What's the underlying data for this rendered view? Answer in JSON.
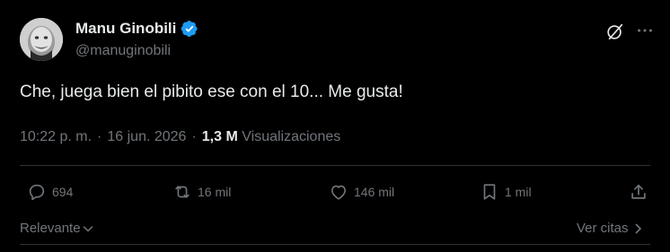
{
  "author": {
    "name": "Manu Ginobili",
    "handle": "@manuginobili",
    "verified": true,
    "verified_color": "#1d9bf0"
  },
  "tweet": {
    "text": "Che, juega bien el pibito ese con el 10... Me gusta!",
    "time": "10:22 p. m.",
    "date": "16 jun. 2026",
    "views_count": "1,3 M",
    "views_label": "Visualizaciones"
  },
  "actions": {
    "replies": "694",
    "retweets": "16 mil",
    "likes": "146 mil",
    "bookmarks": "1 mil"
  },
  "footer": {
    "sort_label": "Relevante",
    "quotes_label": "Ver citas"
  },
  "icons": {
    "top_right": [
      "grok-icon",
      "more-icon"
    ],
    "actions": [
      "reply-icon",
      "retweet-icon",
      "like-icon",
      "bookmark-icon",
      "share-icon"
    ]
  },
  "colors": {
    "background": "#000000",
    "text_primary": "#e7e9ea",
    "text_secondary": "#71767b",
    "divider": "#2f3336"
  }
}
